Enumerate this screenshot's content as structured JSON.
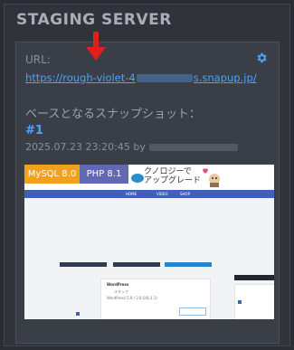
{
  "header": {
    "title": "STAGING SERVER"
  },
  "panel": {
    "url_label": "URL:",
    "url_prefix": "https://rough-violet-4",
    "url_suffix": "s.snapup.jp/",
    "snapshot_title": "ベースとなるスナップショット：",
    "snapshot_number": "#1",
    "snapshot_date": "2025.07.23 23:20:45 by"
  },
  "thumbnail": {
    "mysql_badge": "MySQL 8.0",
    "php_badge": "PHP 8.1",
    "site_logo_line1": "クノロジーで",
    "site_logo_line2": "アップグレード",
    "nav_items": [
      "HOME",
      "VIDEO",
      "SHOP"
    ],
    "widget_title": "WordPress",
    "widget_line1": "スタッフ",
    "widget_line2": "WordPress 5.9 / 2.8.0(8.1.1)"
  },
  "colors": {
    "accent_link": "#4aa3ff",
    "mysql": "#f0a21a",
    "php": "#6169b3",
    "arrow": "#e0201c"
  },
  "icons": {
    "settings": "gear-icon",
    "pointer": "arrow-down-icon"
  }
}
